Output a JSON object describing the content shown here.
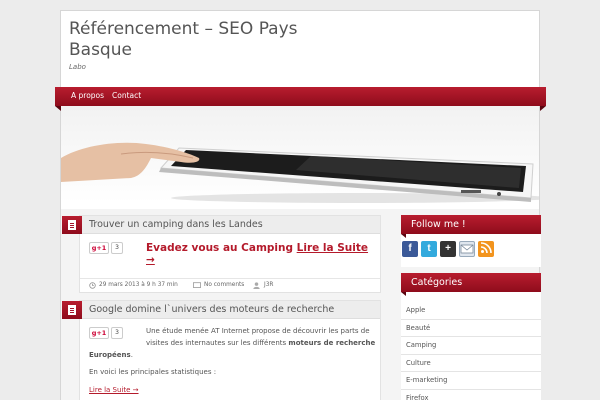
{
  "site": {
    "title": "Référencement – SEO Pays Basque",
    "tagline": "Labo"
  },
  "nav": {
    "items": [
      {
        "label": "A propos"
      },
      {
        "label": "Contact"
      }
    ]
  },
  "posts": [
    {
      "title": "Trouver un camping dans les Landes",
      "gplus_label": "g+1",
      "gplus_count": "3",
      "cta_text": "Evadez vous au Camping ",
      "cta_link": "Lire la Suite →",
      "meta": {
        "date": "29 mars 2013 à 9 h 37 min",
        "comments": "No comments",
        "author": "J3R"
      }
    },
    {
      "title": "Google domine l`univers des moteurs de recherche",
      "gplus_label": "g+1",
      "gplus_count": "3",
      "excerpt_line1": "Une étude menée AT Internet propose de découvrir les parts de",
      "excerpt_line2_pre": "visites des internautes sur les différents ",
      "excerpt_line2_bold": "moteurs de recherche",
      "excerpt_line3_bold": "Européens",
      "excerpt_line3_post": ".",
      "stats_line": "En voici les principales statistiques :",
      "read_more": "Lire la Suite →"
    }
  ],
  "sidebar": {
    "follow": {
      "title": "Follow me !",
      "icons": [
        "facebook-icon",
        "twitter-icon",
        "google-plus-icon",
        "email-icon",
        "rss-icon"
      ]
    },
    "categories": {
      "title": "Catégories",
      "items": [
        "Apple",
        "Beauté",
        "Camping",
        "Culture",
        "E-marketing",
        "Firefox"
      ]
    }
  },
  "colors": {
    "accent": "#a3142a",
    "link": "#b41a2b"
  }
}
